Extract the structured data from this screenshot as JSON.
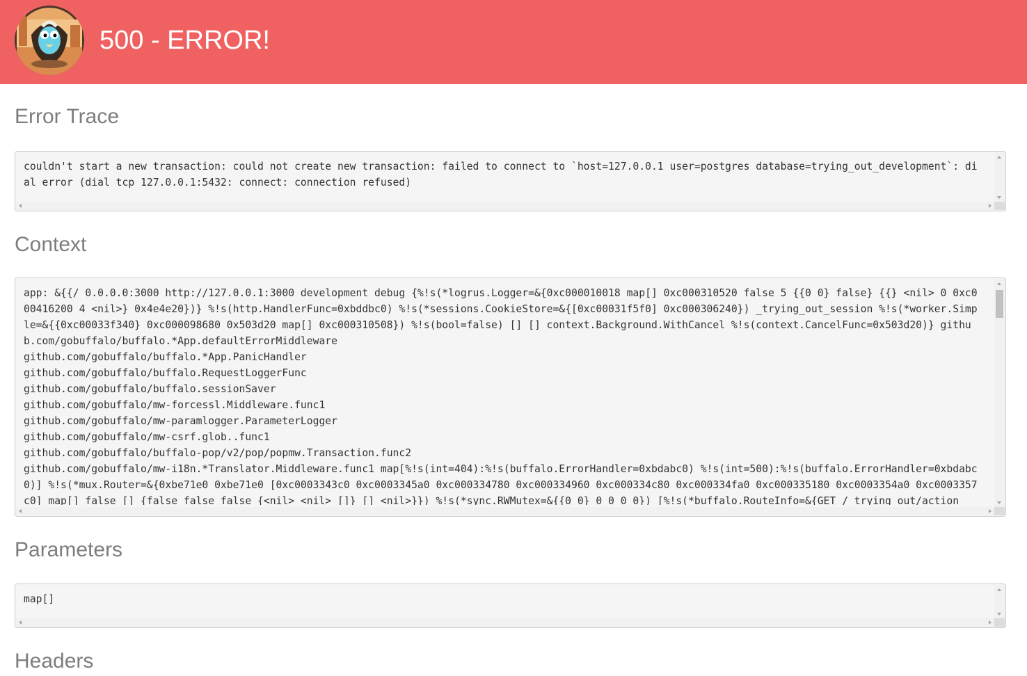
{
  "header": {
    "title": "500 - ERROR!",
    "logo_icon": "gobuffalo-gopher-logo",
    "background_color": "#f06262"
  },
  "sections": {
    "error_trace": {
      "title": "Error Trace",
      "content": "couldn't start a new transaction: could not create new transaction: failed to connect to `host=127.0.0.1 user=postgres database=trying_out_development`: dial error (dial tcp 127.0.0.1:5432: connect: connection refused)"
    },
    "context": {
      "title": "Context",
      "content": "app: &{{/ 0.0.0.0:3000 http://127.0.0.1:3000 development debug {%!s(*logrus.Logger=&{0xc000010018 map[] 0xc000310520 false 5 {{0 0} false} {{} <nil> 0 0xc000416200 4 <nil>} 0x4e4e20})} %!s(http.HandlerFunc=0xbddbc0) %!s(*sessions.CookieStore=&{[0xc00031f5f0] 0xc000306240}) _trying_out_session %!s(*worker.Simple=&{{0xc00033f340} 0xc000098680 0x503d20 map[] 0xc000310508}) %!s(bool=false) [] [] context.Background.WithCancel %!s(context.CancelFunc=0x503d20)} github.com/gobuffalo/buffalo.*App.defaultErrorMiddleware\ngithub.com/gobuffalo/buffalo.*App.PanicHandler\ngithub.com/gobuffalo/buffalo.RequestLoggerFunc\ngithub.com/gobuffalo/buffalo.sessionSaver\ngithub.com/gobuffalo/mw-forcessl.Middleware.func1\ngithub.com/gobuffalo/mw-paramlogger.ParameterLogger\ngithub.com/gobuffalo/mw-csrf.glob..func1\ngithub.com/gobuffalo/buffalo-pop/v2/pop/popmw.Transaction.func2\ngithub.com/gobuffalo/mw-i18n.*Translator.Middleware.func1 map[%!s(int=404):%!s(buffalo.ErrorHandler=0xbdabc0) %!s(int=500):%!s(buffalo.ErrorHandler=0xbdabc0)] %!s(*mux.Router=&{0xbe71e0 0xbe71e0 [0xc0003343c0 0xc0003345a0 0xc000334780 0xc000334960 0xc000334c80 0xc000334fa0 0xc000335180 0xc0003354a0 0xc0003357c0] map[] false [] {false false false {<nil> <nil> []} [] <nil>}}) %!s(*sync.RWMutex=&{{0 0} 0 0 0 0}) [%!s(*buffalo.RouteInfo=&{GET / trying_out/action"
    },
    "parameters": {
      "title": "Parameters",
      "content": "map[]"
    },
    "headers": {
      "title": "Headers"
    }
  }
}
